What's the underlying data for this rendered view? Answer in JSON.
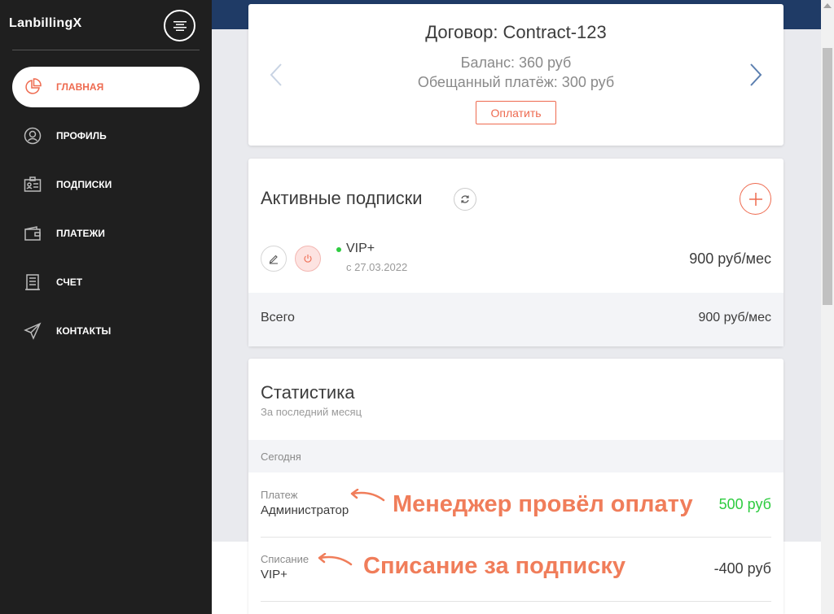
{
  "brand": "LanbillingX",
  "colors": {
    "accent": "#ee6a4f",
    "sidebar_bg": "#1f1f1f",
    "positive": "#2ecc40"
  },
  "sidebar": {
    "items": [
      {
        "label": "ГЛАВНАЯ",
        "icon": "pie-chart-icon",
        "active": true
      },
      {
        "label": "ПРОФИЛЬ",
        "icon": "profile-icon"
      },
      {
        "label": "ПОДПИСКИ",
        "icon": "id-card-icon"
      },
      {
        "label": "ПЛАТЕЖИ",
        "icon": "wallet-icon"
      },
      {
        "label": "СЧЕТ",
        "icon": "invoice-icon"
      },
      {
        "label": "КОНТАКТЫ",
        "icon": "paper-plane-icon"
      }
    ]
  },
  "contract": {
    "title": "Договор: Contract-123",
    "balance": "Баланс: 360 руб",
    "promised": "Обещанный платёж: 300 руб",
    "pay_label": "Оплатить"
  },
  "subscriptions": {
    "title": "Активные подписки",
    "items": [
      {
        "name": "VIP+",
        "since": "с 27.03.2022",
        "price": "900 руб/мес",
        "status": "active"
      }
    ],
    "total_label": "Всего",
    "total_value": "900 руб/мес"
  },
  "statistics": {
    "title": "Статистика",
    "subtitle": "За последний месяц",
    "group_label": "Сегодня",
    "transactions": [
      {
        "type": "Платеж",
        "who": "Администратор",
        "amount": "500 руб",
        "amount_color": "#2ecc40",
        "annotation": "Менеджер провёл оплату"
      },
      {
        "type": "Списание",
        "who": "VIP+",
        "amount": "-400 руб",
        "amount_color": "#3c3c3c",
        "annotation": "Списание за подписку"
      }
    ]
  }
}
